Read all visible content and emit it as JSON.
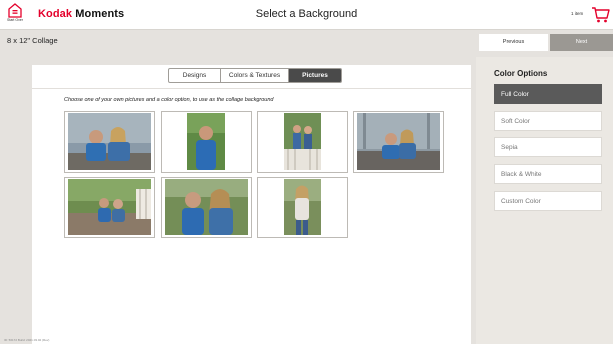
{
  "header": {
    "start_over_label": "Start Over",
    "brand_red": "Kodak",
    "brand_black": "Moments",
    "title": "Select a Background",
    "cart_count": "1 item"
  },
  "subheader": {
    "product_title": "8 x 12\" Collage",
    "previous_label": "Previous",
    "next_label": "Next"
  },
  "tabs": [
    {
      "label": "Designs",
      "active": false
    },
    {
      "label": "Colors & Textures",
      "active": false
    },
    {
      "label": "Pictures",
      "active": true
    }
  ],
  "instruction": "Choose one of your own pictures and a color option, to use as the collage background",
  "photos": [
    {
      "name": "photo-two-kids-sitting",
      "orientation": "landscape"
    },
    {
      "name": "photo-boy-blue-shirt",
      "orientation": "portrait"
    },
    {
      "name": "photo-kids-on-porch",
      "orientation": "portrait"
    },
    {
      "name": "photo-kids-on-steps",
      "orientation": "landscape"
    },
    {
      "name": "photo-kids-on-deck",
      "orientation": "landscape"
    },
    {
      "name": "photo-kids-smiling",
      "orientation": "landscape"
    },
    {
      "name": "photo-girl-standing",
      "orientation": "portrait"
    }
  ],
  "color_options": {
    "title": "Color Options",
    "items": [
      "Full Color",
      "Soft Color",
      "Sepia",
      "Black & White",
      "Custom Color"
    ],
    "selected": "Full Color"
  },
  "footer_text": "ID: 56172  Build: 2021.03.02 (Rev)",
  "colors": {
    "brand_red": "#e4002b",
    "active_tab": "#4a4a4a",
    "selected_option": "#5a5a5a",
    "next_button": "#9b9893"
  }
}
